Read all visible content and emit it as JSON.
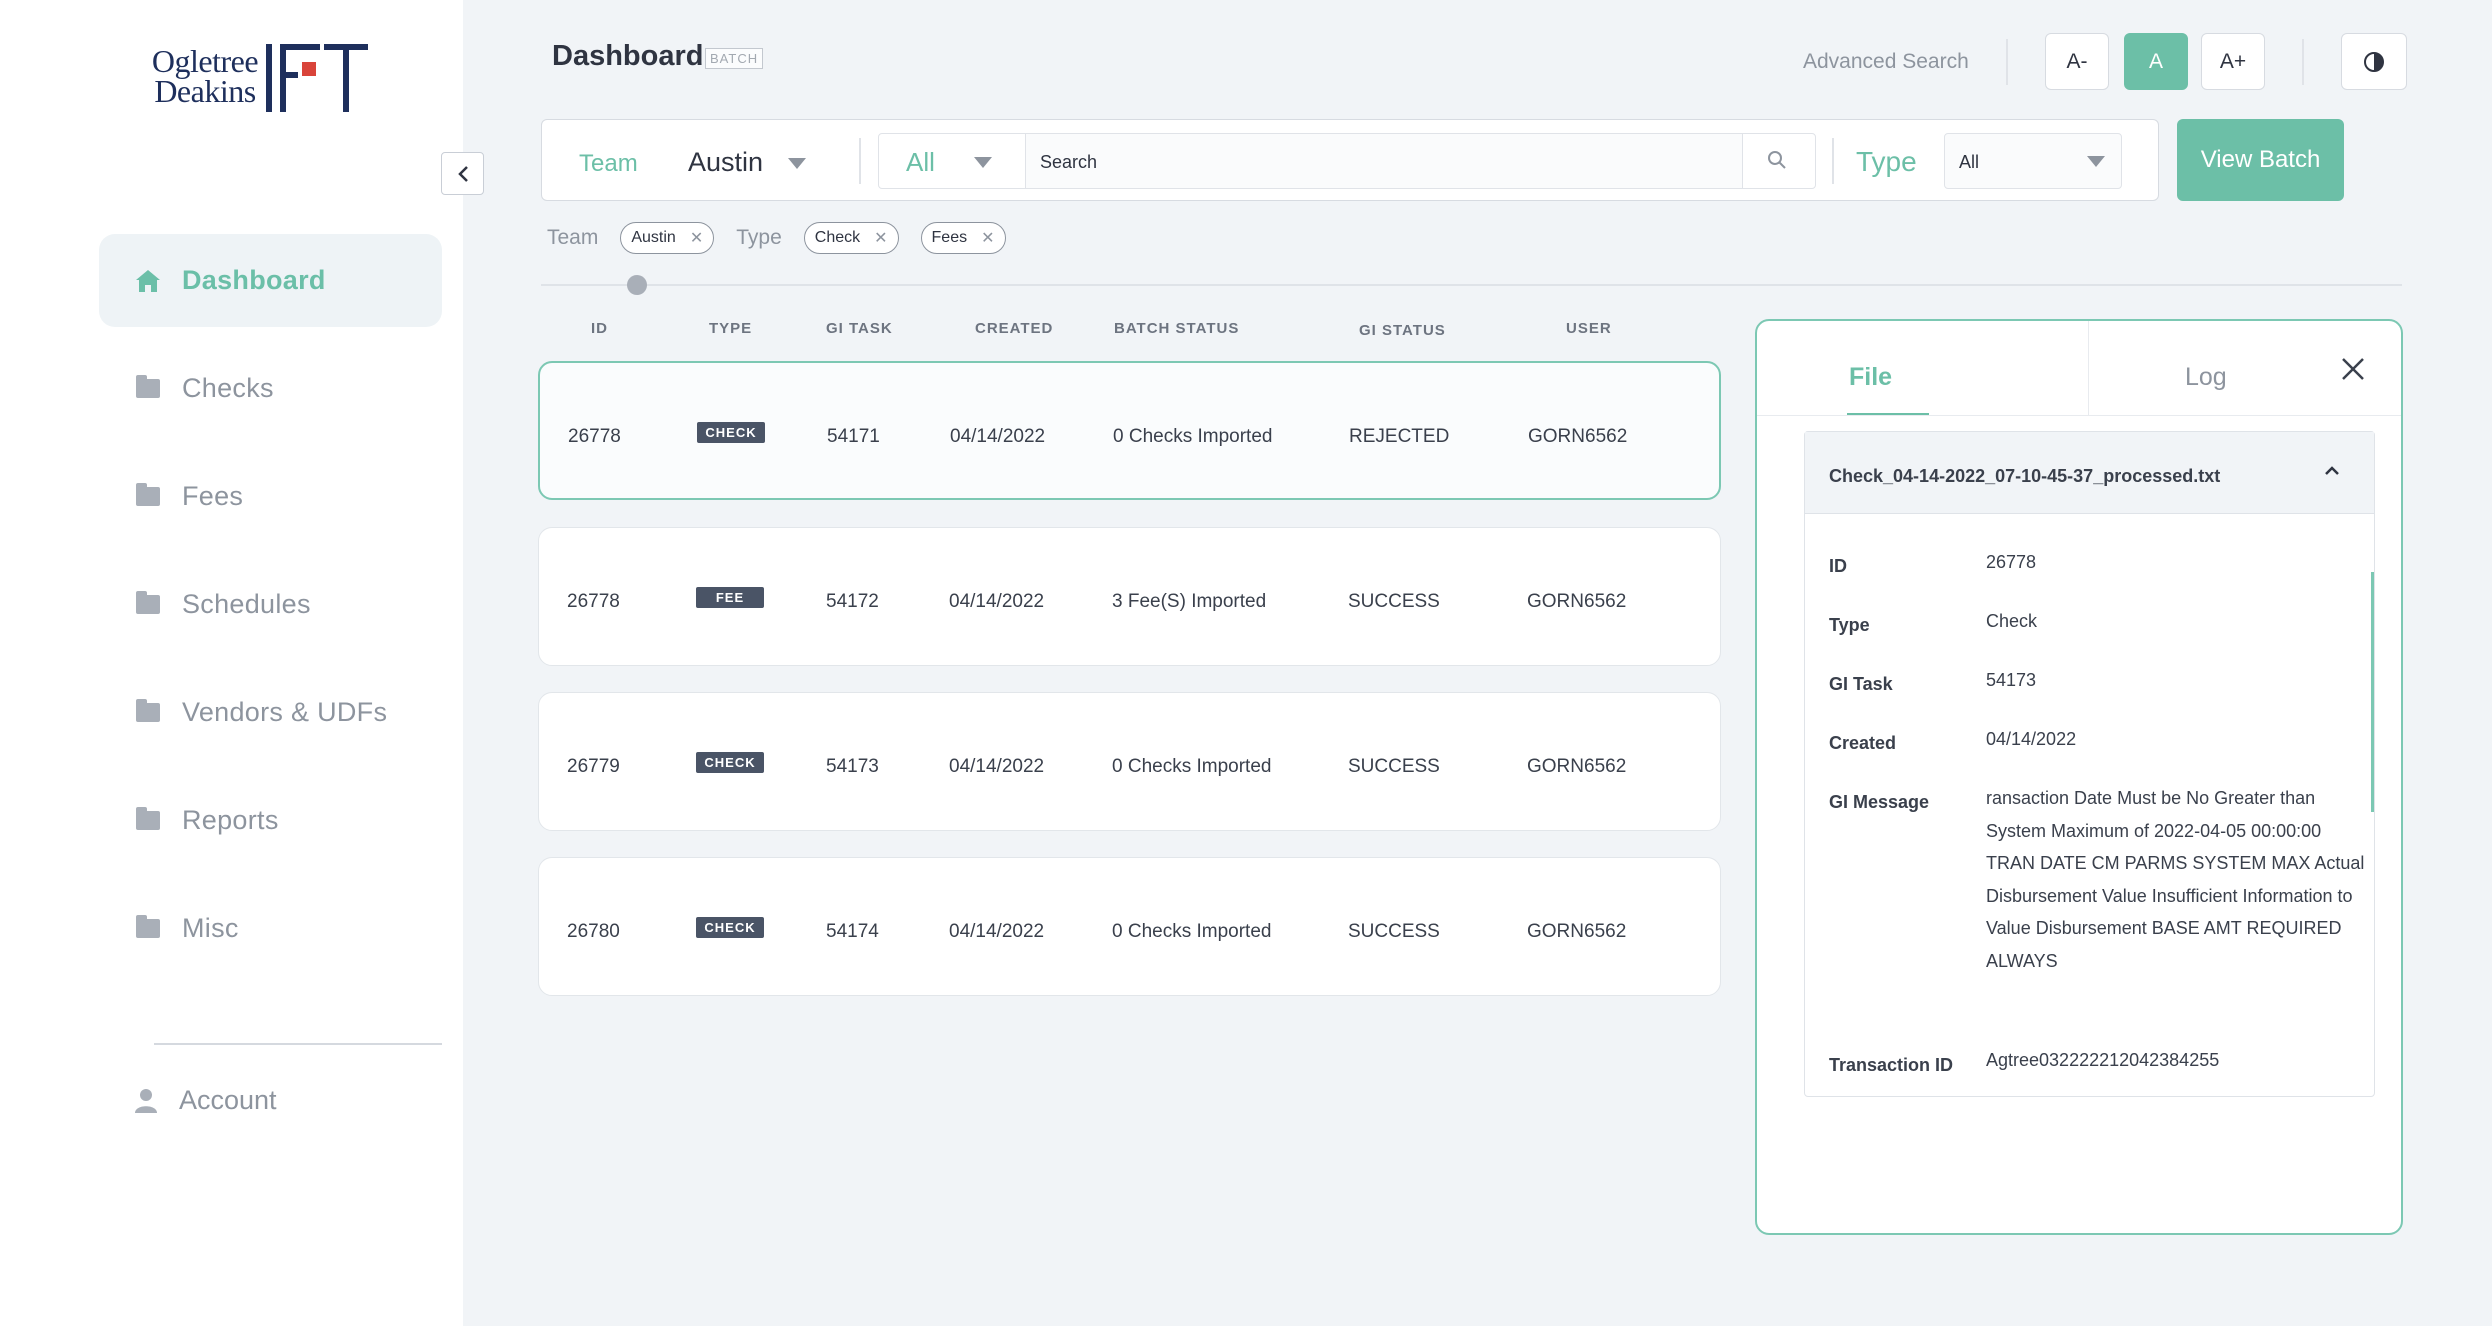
{
  "brand": {
    "logo_text_line1": "Ogletree",
    "logo_text_line2": "Deakins",
    "logo_mark": "FT"
  },
  "sidebar": {
    "items": [
      {
        "label": "Dashboard",
        "icon": "home-icon",
        "active": true
      },
      {
        "label": "Checks",
        "icon": "folder-icon"
      },
      {
        "label": "Fees",
        "icon": "folder-icon"
      },
      {
        "label": "Schedules",
        "icon": "folder-icon"
      },
      {
        "label": "Vendors & UDFs",
        "icon": "folder-icon"
      },
      {
        "label": "Reports",
        "icon": "folder-icon"
      },
      {
        "label": "Misc",
        "icon": "folder-icon"
      }
    ],
    "account_label": "Account"
  },
  "header": {
    "title": "Dashboard",
    "badge": "BATCH",
    "advanced_search": "Advanced Search",
    "font_small": "A-",
    "font_normal": "A",
    "font_large": "A+"
  },
  "filters": {
    "team_label": "Team",
    "team_value": "Austin",
    "scope_value": "All",
    "search_placeholder": "Search",
    "type_label": "Type",
    "type_value": "All",
    "view_batch": "View Batch"
  },
  "active_filters": {
    "team_label": "Team",
    "team_chips": [
      "Austin"
    ],
    "type_label": "Type",
    "type_chips": [
      "Check",
      "Fees"
    ]
  },
  "table": {
    "columns": [
      "ID",
      "TYPE",
      "GI TASK",
      "CREATED",
      "BATCH STATUS",
      "GI STATUS",
      "USER"
    ],
    "rows": [
      {
        "id": "26778",
        "type": "CHECK",
        "gi_task": "54171",
        "created": "04/14/2022",
        "batch_status": "0 Checks Imported",
        "gi_status": "REJECTED",
        "user": "GORN6562"
      },
      {
        "id": "26778",
        "type": "FEE",
        "gi_task": "54172",
        "created": "04/14/2022",
        "batch_status": "3 Fee(S) Imported",
        "gi_status": "SUCCESS",
        "user": "GORN6562"
      },
      {
        "id": "26779",
        "type": "CHECK",
        "gi_task": "54173",
        "created": "04/14/2022",
        "batch_status": "0 Checks Imported",
        "gi_status": "SUCCESS",
        "user": "GORN6562"
      },
      {
        "id": "26780",
        "type": "CHECK",
        "gi_task": "54174",
        "created": "04/14/2022",
        "batch_status": "0 Checks Imported",
        "gi_status": "SUCCESS",
        "user": "GORN6562"
      }
    ]
  },
  "detail": {
    "tab_file": "File",
    "tab_log": "Log",
    "file_name": "Check_04-14-2022_07-10-45-37_processed.txt",
    "fields": {
      "id_label": "ID",
      "id": "26778",
      "type_label": "Type",
      "type": "Check",
      "task_label": "GI Task",
      "task": "54173",
      "created_label": "Created",
      "created": "04/14/2022",
      "message_label": "GI Message",
      "message": "ransaction Date Must be No Greater than System Maximum of 2022-04-05 00:00:00 TRAN DATE CM PARMS SYSTEM MAX Actual Disbursement Value Insufficient Information to Value Disbursement BASE AMT REQUIRED ALWAYS",
      "txn_label": "Transaction ID",
      "txn": "Agtree032222212042384255"
    }
  },
  "colors": {
    "accent": "#6cbfa7",
    "brand_navy": "#1e2f5c",
    "brand_red": "#d9443a",
    "tag_dark": "#4a5466"
  }
}
